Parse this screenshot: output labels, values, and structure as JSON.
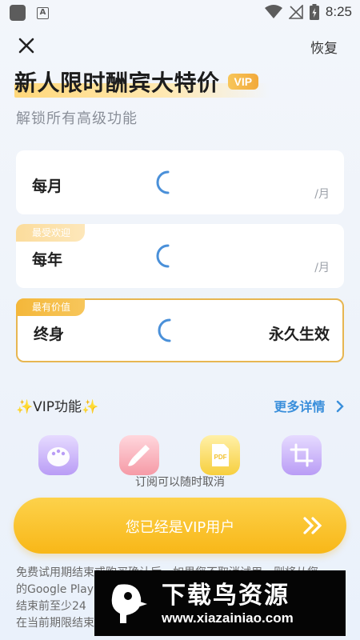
{
  "status_bar": {
    "time": "8:25"
  },
  "header": {
    "restore_label": "恢复"
  },
  "hero": {
    "title": "新人限时酬宾大特价",
    "badge": "VIP",
    "subtitle": "解锁所有高级功能"
  },
  "plans": [
    {
      "tag": "",
      "name": "每月",
      "unit": "/月",
      "right_text": ""
    },
    {
      "tag": "最受欢迎",
      "name": "每年",
      "unit": "/月",
      "right_text": ""
    },
    {
      "tag": "最有价值",
      "name": "终身",
      "unit": "",
      "right_text": "永久生效",
      "selected": true
    }
  ],
  "vip_section": {
    "title": "✨VIP功能✨",
    "more_label": "更多详情"
  },
  "features": [
    "palette-icon",
    "brush-icon",
    "pdf-icon",
    "crop-icon"
  ],
  "cancel_note": "订阅可以随时取消",
  "cta": {
    "label": "您已经是VIP用户"
  },
  "legal": {
    "line1": "免费试用期结束或购买确认后，如果您不取消试用，则将从您",
    "line2": "的Google Play",
    "line3": "结束前至少24",
    "line4": "在当前期限结束"
  },
  "watermark": {
    "title": "下载鸟资源",
    "url": "www.xiazainiao.com"
  },
  "colors": {
    "accent": "#f8b718",
    "link": "#3a8fdb",
    "selected_border": "#e7b651"
  }
}
